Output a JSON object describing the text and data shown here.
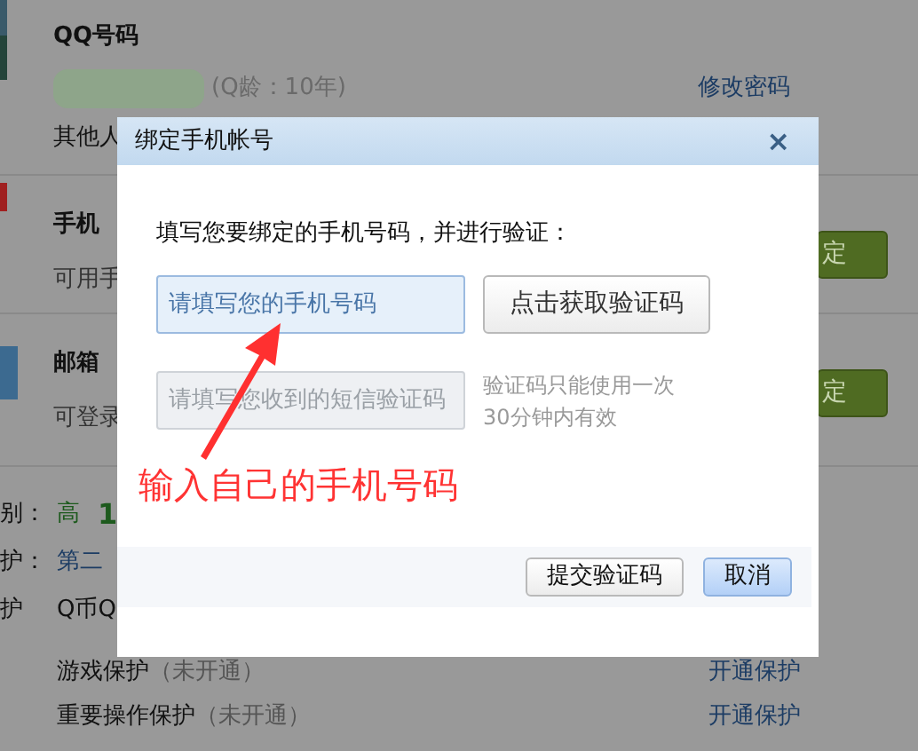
{
  "background": {
    "account": {
      "title": "QQ号码",
      "age": "(Q龄：10年)",
      "link": "修改密码",
      "note": "其他人"
    },
    "services": [
      {
        "title": "手机",
        "desc": "可用手",
        "button": "定"
      },
      {
        "title": "邮箱",
        "desc": "可登录",
        "button": "定"
      }
    ],
    "security": [
      {
        "kind": "level",
        "label": "别：",
        "value": "高",
        "extra": "1"
      },
      {
        "kind": "link",
        "label": "护：",
        "value": "第二"
      },
      {
        "kind": "plain",
        "label": "护",
        "value": "Q币Q"
      }
    ],
    "protections": [
      {
        "name": "游戏保护",
        "status": "（未开通）",
        "action": "开通保护"
      },
      {
        "name": "重要操作保护",
        "status": "（未开通）",
        "action": "开通保护"
      }
    ]
  },
  "dialog": {
    "title": "绑定手机帐号",
    "close": "×",
    "instruction": "填写您要绑定的手机号码，并进行验证：",
    "phone_field": {
      "placeholder": "请填写您的手机号码",
      "focused": true
    },
    "get_code_button": "点击获取验证码",
    "code_field": {
      "placeholder": "请填写您收到的短信验证码",
      "disabled": true
    },
    "code_note": [
      "验证码只能使用一次",
      "30分钟内有效"
    ],
    "buttons": [
      {
        "label": "提交验证码",
        "primary": false
      },
      {
        "label": "取消",
        "primary": true
      }
    ]
  },
  "annotation": {
    "text": "输入自己的手机号码"
  }
}
